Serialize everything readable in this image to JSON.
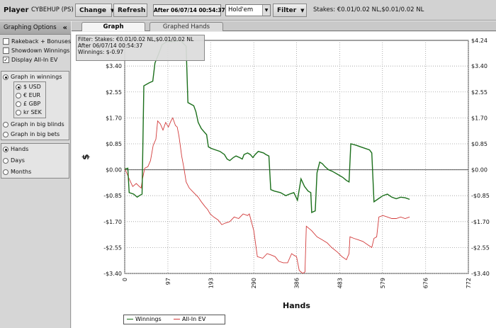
{
  "toolbar": {
    "player_label": "Player",
    "player_name": "CYBEHUP (PS)",
    "change_label": "Change",
    "refresh_label": "Refresh",
    "after_label": "After 06/07/14 00:54:37",
    "game_select": "Hold'em",
    "filter_label": "Filter",
    "stakes_text": "Stakes: €0.01/0.02 NL,$0.01/0.02 NL"
  },
  "sidebar": {
    "header": "Graphing Options",
    "collapse": "«",
    "options": [
      {
        "label": "Rakeback + Bonuses",
        "checked": false
      },
      {
        "label": "Showdown Winnings",
        "checked": false
      },
      {
        "label": "Display All-In EV",
        "checked": true
      }
    ],
    "graph_in_winnings": "Graph in winnings",
    "currencies": [
      {
        "label": "$ USD",
        "selected": true
      },
      {
        "label": "€ EUR",
        "selected": false
      },
      {
        "label": "£ GBP",
        "selected": false
      },
      {
        "label": "kr SEK",
        "selected": false
      }
    ],
    "graph_in_big_blinds": "Graph in big blinds",
    "graph_in_big_bets": "Graph in big bets",
    "x_axis_options": [
      {
        "label": "Hands",
        "selected": true
      },
      {
        "label": "Days",
        "selected": false
      },
      {
        "label": "Months",
        "selected": false
      }
    ]
  },
  "tabs": [
    {
      "label": "Graph",
      "active": true
    },
    {
      "label": "Graphed Hands",
      "active": false
    }
  ],
  "filter_box": {
    "line1": "Filter: Stakes: €0.01/0.02 NL,$0.01/0.02 NL",
    "line2": "After 06/07/14 00:54:37",
    "line3": "Winnings: $-0.97"
  },
  "chart_data": {
    "type": "line",
    "xlabel": "Hands",
    "ylabel": "$",
    "xlim": [
      0,
      772
    ],
    "ylim": [
      -3.4,
      4.24
    ],
    "x_ticks": [
      "0",
      "97",
      "193",
      "290",
      "386",
      "483",
      "579",
      "676",
      "772"
    ],
    "y_ticks_left": [
      "$3.40",
      "$2.55",
      "$1.70",
      "$0.85",
      "$0.00",
      "-$0.85",
      "-$1.70",
      "-$2.55",
      "-$3.40"
    ],
    "y_ticks_right": [
      "$4.24",
      "$3.40",
      "$2.55",
      "$1.70",
      "$0.85",
      "$0.00",
      "-$0.85",
      "-$1.70",
      "-$2.55",
      "-$3.40"
    ],
    "grid": true,
    "legend_position": "bottom-left",
    "series": [
      {
        "name": "Winnings",
        "color": "#1a6e1a",
        "points": [
          [
            0,
            0.02
          ],
          [
            7,
            0.05
          ],
          [
            10,
            -0.75
          ],
          [
            20,
            -0.8
          ],
          [
            28,
            -0.9
          ],
          [
            33,
            -0.85
          ],
          [
            39,
            -0.8
          ],
          [
            43,
            2.75
          ],
          [
            55,
            2.85
          ],
          [
            63,
            2.9
          ],
          [
            68,
            3.5
          ],
          [
            75,
            3.75
          ],
          [
            84,
            4.1
          ],
          [
            95,
            4.2
          ],
          [
            110,
            4.2
          ],
          [
            125,
            4.24
          ],
          [
            138,
            4.05
          ],
          [
            142,
            2.2
          ],
          [
            155,
            2.1
          ],
          [
            160,
            1.9
          ],
          [
            165,
            1.55
          ],
          [
            172,
            1.35
          ],
          [
            178,
            1.25
          ],
          [
            184,
            1.15
          ],
          [
            188,
            0.75
          ],
          [
            194,
            0.7
          ],
          [
            204,
            0.65
          ],
          [
            214,
            0.6
          ],
          [
            224,
            0.5
          ],
          [
            230,
            0.35
          ],
          [
            236,
            0.3
          ],
          [
            244,
            0.4
          ],
          [
            250,
            0.45
          ],
          [
            258,
            0.4
          ],
          [
            264,
            0.35
          ],
          [
            268,
            0.5
          ],
          [
            276,
            0.55
          ],
          [
            282,
            0.5
          ],
          [
            288,
            0.4
          ],
          [
            293,
            0.5
          ],
          [
            300,
            0.6
          ],
          [
            312,
            0.55
          ],
          [
            317,
            0.5
          ],
          [
            324,
            0.45
          ],
          [
            328,
            -0.65
          ],
          [
            336,
            -0.7
          ],
          [
            350,
            -0.75
          ],
          [
            362,
            -0.85
          ],
          [
            370,
            -0.8
          ],
          [
            380,
            -0.75
          ],
          [
            388,
            -1.0
          ],
          [
            396,
            -0.3
          ],
          [
            404,
            -0.55
          ],
          [
            412,
            -0.7
          ],
          [
            418,
            -0.75
          ],
          [
            420,
            -1.4
          ],
          [
            428,
            -1.35
          ],
          [
            432,
            -0.1
          ],
          [
            438,
            0.25
          ],
          [
            444,
            0.2
          ],
          [
            450,
            0.1
          ],
          [
            458,
            0.0
          ],
          [
            466,
            -0.05
          ],
          [
            478,
            -0.15
          ],
          [
            490,
            -0.25
          ],
          [
            498,
            -0.35
          ],
          [
            504,
            -0.4
          ],
          [
            508,
            0.85
          ],
          [
            520,
            0.8
          ],
          [
            530,
            0.75
          ],
          [
            540,
            0.7
          ],
          [
            550,
            0.65
          ],
          [
            555,
            0.55
          ],
          [
            560,
            -1.05
          ],
          [
            570,
            -0.95
          ],
          [
            580,
            -0.85
          ],
          [
            590,
            -0.8
          ],
          [
            600,
            -0.9
          ],
          [
            610,
            -0.95
          ],
          [
            620,
            -0.9
          ],
          [
            630,
            -0.92
          ],
          [
            640,
            -0.97
          ]
        ]
      },
      {
        "name": "All-In EV",
        "color": "#d23a3a",
        "points": [
          [
            0,
            0.05
          ],
          [
            10,
            -0.3
          ],
          [
            18,
            -0.55
          ],
          [
            26,
            -0.45
          ],
          [
            33,
            -0.55
          ],
          [
            37,
            -0.6
          ],
          [
            40,
            -0.3
          ],
          [
            45,
            0.05
          ],
          [
            52,
            0.1
          ],
          [
            58,
            0.3
          ],
          [
            64,
            0.8
          ],
          [
            70,
            1.0
          ],
          [
            74,
            1.6
          ],
          [
            80,
            1.5
          ],
          [
            86,
            1.3
          ],
          [
            92,
            1.55
          ],
          [
            98,
            1.4
          ],
          [
            104,
            1.6
          ],
          [
            108,
            1.7
          ],
          [
            114,
            1.45
          ],
          [
            118,
            1.4
          ],
          [
            122,
            1.1
          ],
          [
            128,
            0.45
          ],
          [
            133,
            0.05
          ],
          [
            138,
            -0.4
          ],
          [
            145,
            -0.6
          ],
          [
            155,
            -0.75
          ],
          [
            165,
            -0.9
          ],
          [
            172,
            -1.05
          ],
          [
            180,
            -1.2
          ],
          [
            186,
            -1.3
          ],
          [
            192,
            -1.45
          ],
          [
            200,
            -1.55
          ],
          [
            210,
            -1.65
          ],
          [
            218,
            -1.8
          ],
          [
            226,
            -1.75
          ],
          [
            236,
            -1.7
          ],
          [
            246,
            -1.55
          ],
          [
            256,
            -1.6
          ],
          [
            266,
            -1.45
          ],
          [
            276,
            -1.5
          ],
          [
            280,
            -1.45
          ],
          [
            290,
            -2.0
          ],
          [
            298,
            -2.85
          ],
          [
            310,
            -2.9
          ],
          [
            320,
            -2.75
          ],
          [
            330,
            -2.8
          ],
          [
            338,
            -2.85
          ],
          [
            346,
            -3.0
          ],
          [
            356,
            -3.05
          ],
          [
            366,
            -3.05
          ],
          [
            375,
            -2.75
          ],
          [
            380,
            -2.8
          ],
          [
            386,
            -2.85
          ],
          [
            392,
            -3.3
          ],
          [
            400,
            -3.4
          ],
          [
            405,
            -3.35
          ],
          [
            408,
            -1.85
          ],
          [
            420,
            -2.0
          ],
          [
            432,
            -2.2
          ],
          [
            444,
            -2.3
          ],
          [
            455,
            -2.4
          ],
          [
            465,
            -2.55
          ],
          [
            478,
            -2.7
          ],
          [
            488,
            -2.85
          ],
          [
            498,
            -2.95
          ],
          [
            504,
            -2.75
          ],
          [
            506,
            -2.2
          ],
          [
            515,
            -2.25
          ],
          [
            525,
            -2.3
          ],
          [
            535,
            -2.35
          ],
          [
            545,
            -2.45
          ],
          [
            555,
            -2.55
          ],
          [
            560,
            -2.25
          ],
          [
            566,
            -2.2
          ],
          [
            571,
            -1.55
          ],
          [
            580,
            -1.5
          ],
          [
            590,
            -1.55
          ],
          [
            600,
            -1.6
          ],
          [
            610,
            -1.6
          ],
          [
            620,
            -1.55
          ],
          [
            630,
            -1.6
          ],
          [
            640,
            -1.55
          ]
        ]
      }
    ]
  }
}
